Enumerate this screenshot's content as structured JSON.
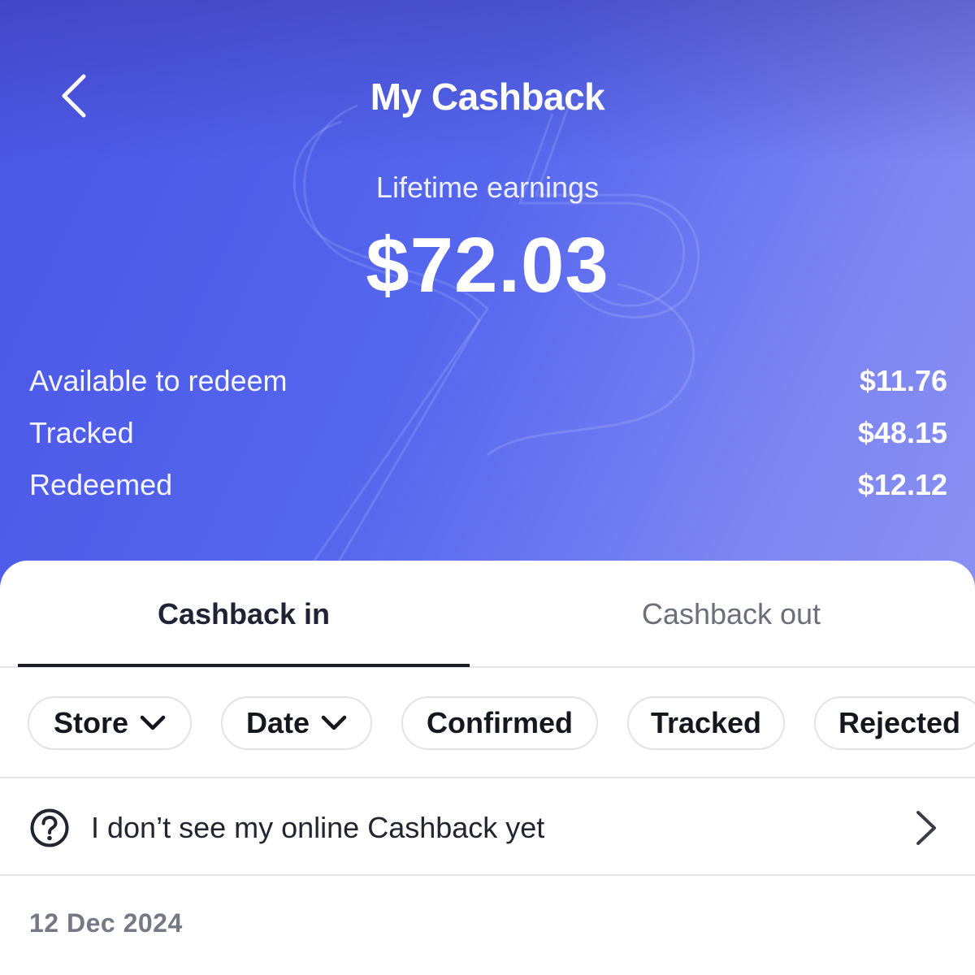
{
  "header": {
    "title": "My Cashback",
    "back_icon": "chevron-left-icon"
  },
  "summary": {
    "lifetime_label": "Lifetime earnings",
    "lifetime_value": "$72.03",
    "rows": [
      {
        "label": "Available to redeem",
        "value": "$11.76"
      },
      {
        "label": "Tracked",
        "value": "$48.15"
      },
      {
        "label": "Redeemed",
        "value": "$12.12"
      }
    ]
  },
  "tabs": [
    {
      "label": "Cashback in",
      "active": true
    },
    {
      "label": "Cashback out",
      "active": false
    }
  ],
  "filters": [
    {
      "label": "Store",
      "dropdown": true
    },
    {
      "label": "Date",
      "dropdown": true
    },
    {
      "label": "Confirmed",
      "dropdown": false
    },
    {
      "label": "Tracked",
      "dropdown": false
    },
    {
      "label": "Rejected",
      "dropdown": false
    }
  ],
  "help": {
    "icon": "question-circle-icon",
    "text": "I don’t see my online Cashback yet",
    "chevron": "chevron-right-icon"
  },
  "list": {
    "date_heading": "12 Dec 2024"
  },
  "colors": {
    "hero_start": "#4a55e6",
    "hero_end": "#8a91f2",
    "active_tab": "#1f2333",
    "inactive_tab": "#6c6f7a"
  }
}
